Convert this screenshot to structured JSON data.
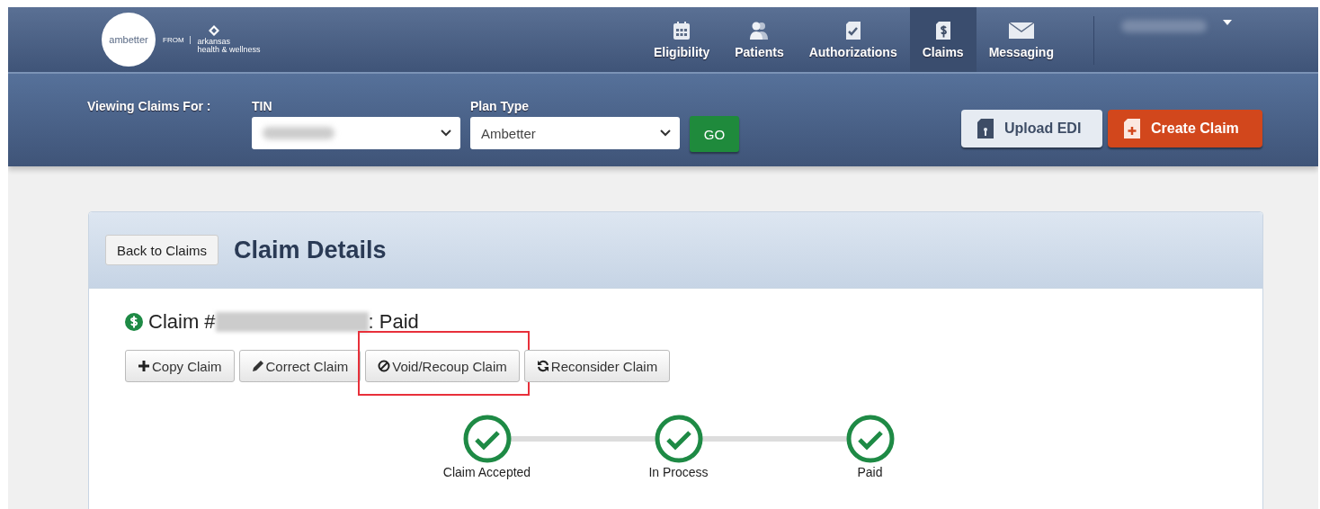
{
  "logo": {
    "brand": "ambetter",
    "from": "FROM",
    "partner_top": "arkansas",
    "partner_bottom": "health & wellness"
  },
  "nav": [
    {
      "label": "Eligibility",
      "kind": "calendar",
      "selected": false
    },
    {
      "label": "Patients",
      "kind": "people",
      "selected": false
    },
    {
      "label": "Authorizations",
      "kind": "checklist",
      "selected": false
    },
    {
      "label": "Claims",
      "kind": "invoice",
      "selected": true
    },
    {
      "label": "Messaging",
      "kind": "mail",
      "selected": false
    }
  ],
  "filter": {
    "label": "Viewing Claims For :",
    "tin_label": "TIN",
    "plan_label": "Plan Type",
    "plan_value": "Ambetter",
    "go": "GO"
  },
  "header_actions": [
    {
      "label": "Upload EDI",
      "kind": "secondary"
    },
    {
      "label": "Create Claim",
      "kind": "primary"
    }
  ],
  "card": {
    "back": "Back to Claims",
    "title": "Claim Details",
    "claim_prefix": "Claim #",
    "claim_status": ": Paid",
    "actions": [
      {
        "label": "Copy Claim",
        "kind": "copy",
        "highlighted": false
      },
      {
        "label": "Correct Claim",
        "kind": "correct",
        "highlighted": false
      },
      {
        "label": "Void/Recoup Claim",
        "kind": "void",
        "highlighted": true
      },
      {
        "label": "Reconsider Claim",
        "kind": "reconsider",
        "highlighted": false
      }
    ],
    "steps": [
      {
        "label": "Claim Accepted",
        "done": true
      },
      {
        "label": "In Process",
        "done": true
      },
      {
        "label": "Paid",
        "done": true
      }
    ]
  }
}
